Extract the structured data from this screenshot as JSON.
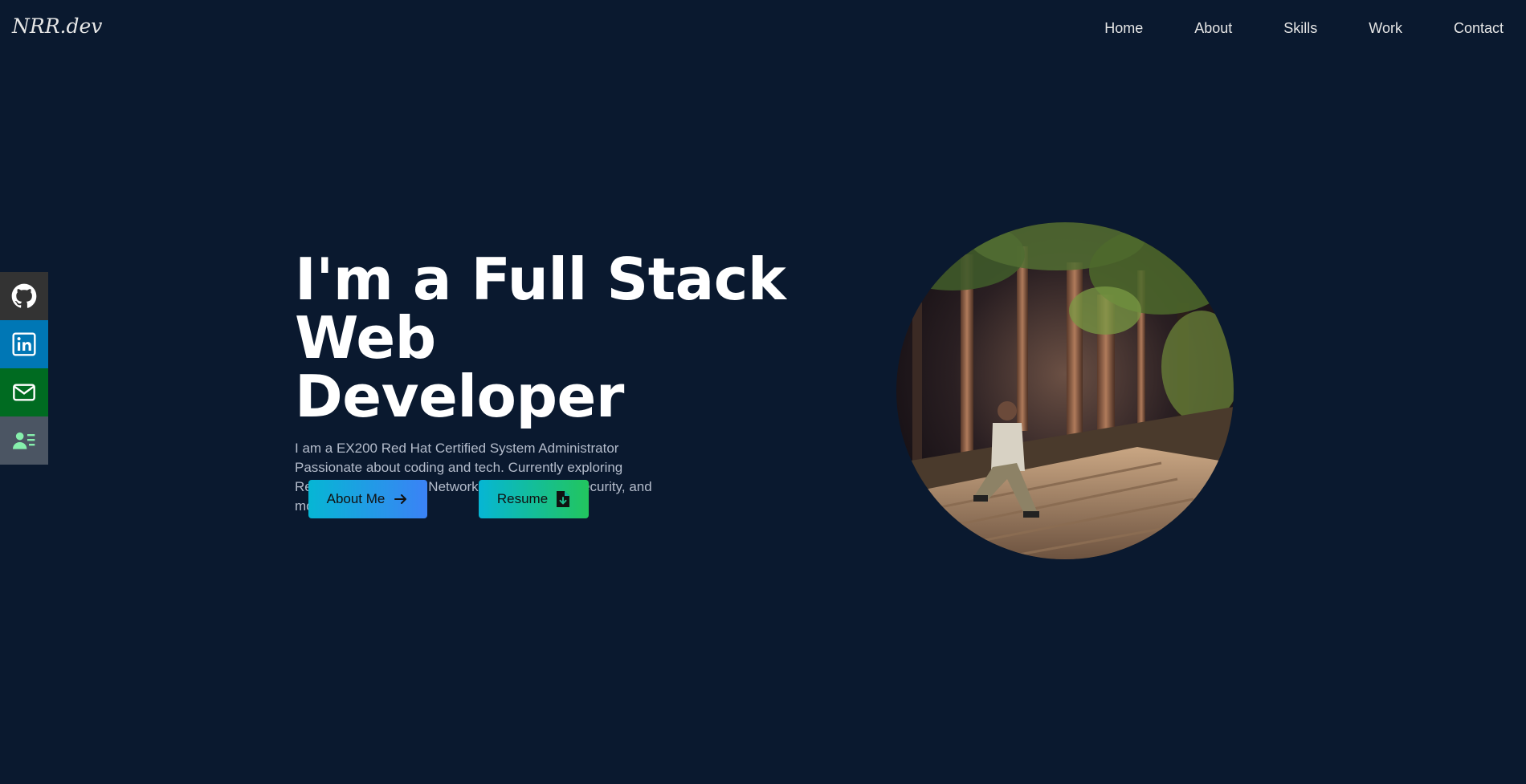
{
  "navbar": {
    "logo": "NRR.dev",
    "links": [
      "Home",
      "About",
      "Skills",
      "Work",
      "Contact"
    ]
  },
  "social": [
    {
      "icon": "github-icon",
      "color": "#333333"
    },
    {
      "icon": "linkedin-icon",
      "color": "#0077b5"
    },
    {
      "icon": "mail-icon",
      "color": "#006b21"
    },
    {
      "icon": "resume-icon",
      "color": "#4b5563"
    }
  ],
  "hero": {
    "title_line1": "I'm a Full Stack Web",
    "title_line2": "Developer",
    "description": "I am a EX200 Red Hat Certified System Administrator Passionate about coding and tech. Currently exploring ReactJS, open-stack, Network analysis, Cybersecurity, and more",
    "about_button": "About Me",
    "resume_button": "Resume"
  },
  "colors": {
    "background": "#0a192f",
    "about_gradient": [
      "#06b6d4",
      "#3b82f6"
    ],
    "resume_gradient": [
      "#06b6d4",
      "#22c55e"
    ]
  }
}
